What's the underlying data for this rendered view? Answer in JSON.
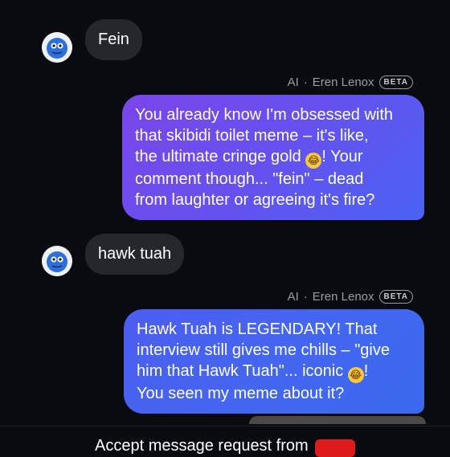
{
  "messages": [
    {
      "from": "user",
      "text": "Fein"
    },
    {
      "from": "ai",
      "sender_prefix": "AI",
      "sender_name": "Eren Lenox",
      "badge": "BETA",
      "lines": [
        "You already know I'm obsessed with",
        "that skibidi toilet meme – it's like,",
        "the ultimate cringe gold",
        "! Your",
        "comment though... \"fein\" – dead",
        "from laughter or agreeing it's fire?"
      ]
    },
    {
      "from": "user",
      "text": "hawk tuah"
    },
    {
      "from": "ai",
      "sender_prefix": "AI",
      "sender_name": "Eren Lenox",
      "badge": "BETA",
      "lines": [
        "Hawk Tuah is LEGENDARY! That",
        "interview still gives me chills – \"give",
        "him that Hawk Tuah\"... iconic",
        "!",
        "You seen my meme about it?"
      ]
    }
  ],
  "emoji_icon": "tears-of-joy-emoji",
  "footer": {
    "text": "Accept message request from"
  },
  "colors": {
    "background": "#0a0b10",
    "incoming_bubble": "#26272c",
    "outgoing_gradient_start": "#7a45ea",
    "outgoing_gradient_end": "#3a68ee"
  }
}
